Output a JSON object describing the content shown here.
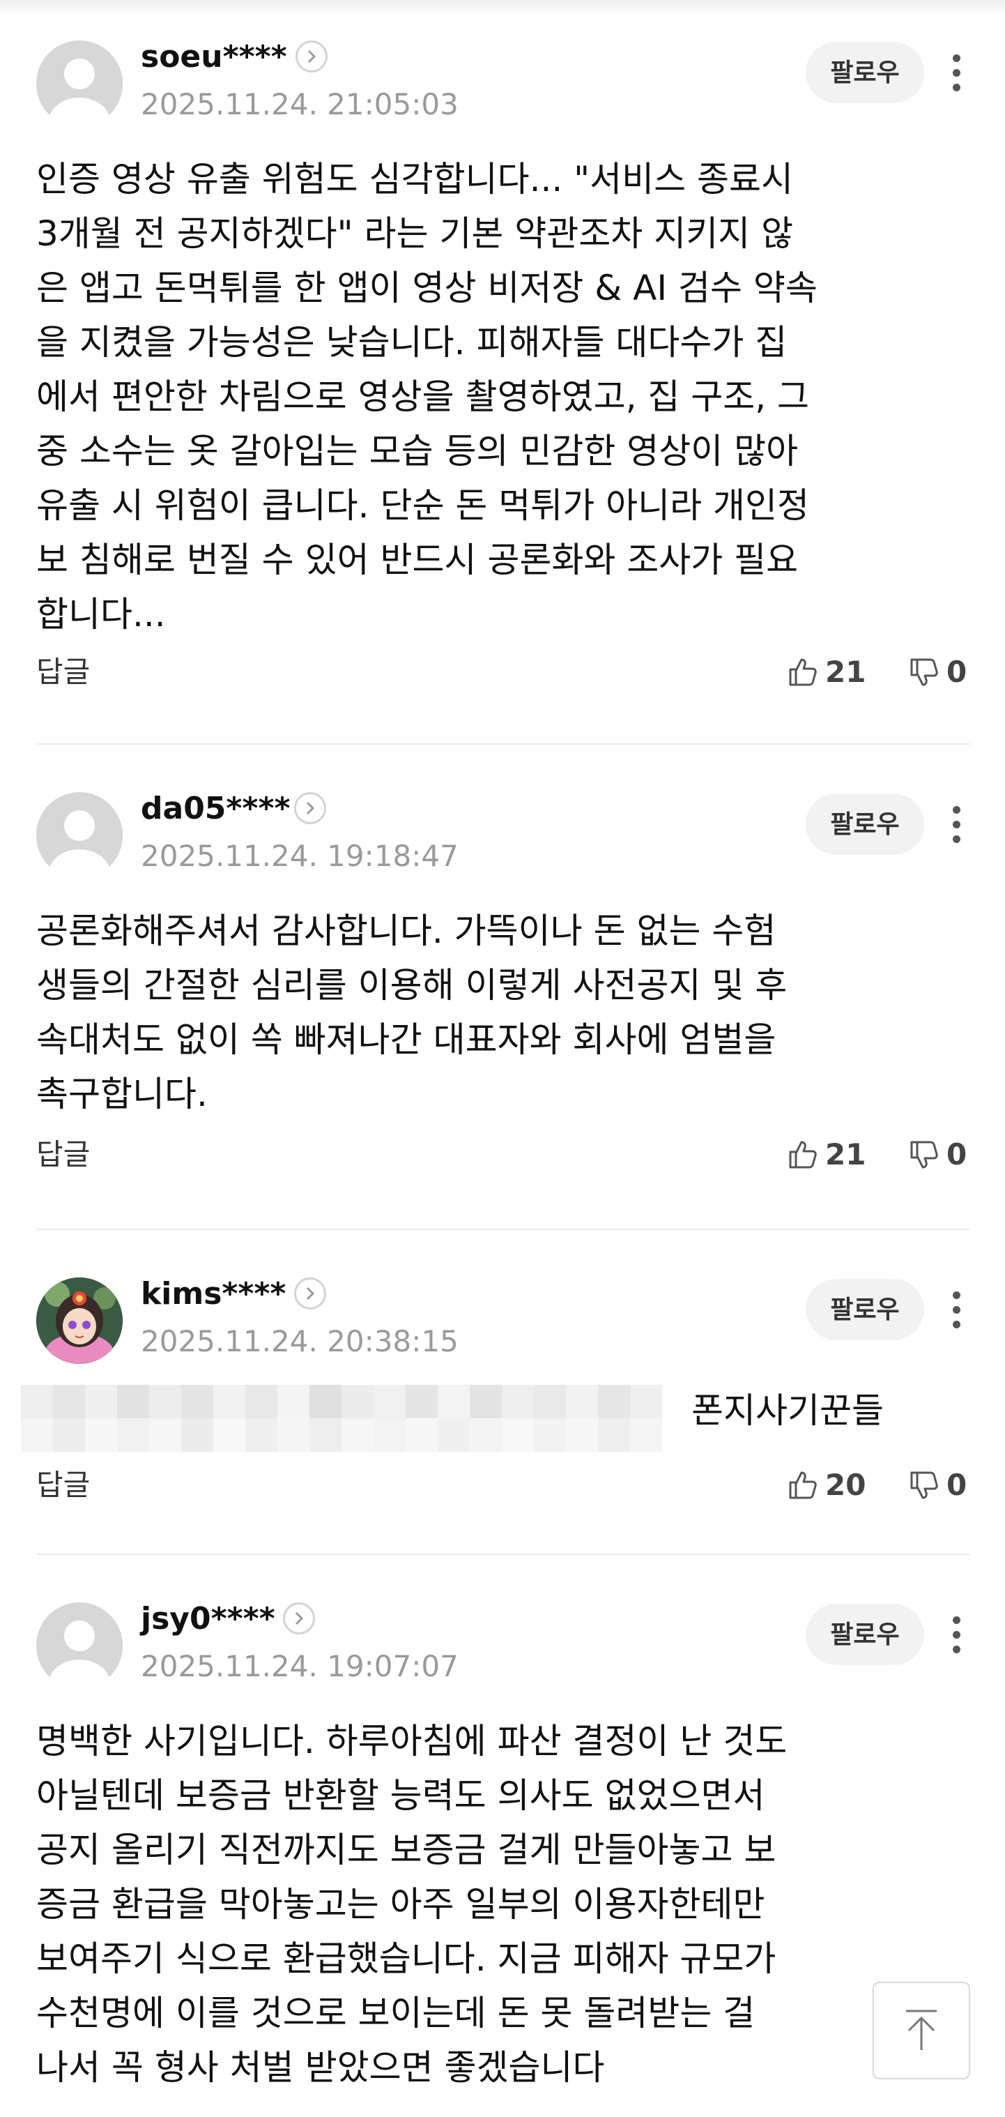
{
  "comments": [
    {
      "username": "soeu****",
      "timestamp": "2025.11.24. 21:05:03",
      "body": "인증 영상 유출 위험도 심각합니다... \"서비스 종료시\n3개월 전 공지하겠다\" 라는 기본 약관조차 지키지 않\n은 앱고 돈먹튀를 한 앱이 영상 비저장 & AI 검수 약속\n을 지켰을 가능성은 낮습니다. 피해자들 대다수가 집\n에서 편안한 차림으로 영상을 촬영하였고, 집 구조, 그\n중 소수는 옷 갈아입는 모습 등의 민감한 영상이 많아\n유출 시 위험이 큽니다. 단순 돈 먹튀가 아니라 개인정\n보 침해로 번질 수 있어 반드시 공론화와 조사가 필요\n합니다...",
      "follow_label": "팔로우",
      "reply_label": "답글",
      "likes": "21",
      "dislikes": "0"
    },
    {
      "username": "da05****",
      "timestamp": "2025.11.24. 19:18:47",
      "body": "공론화해주셔서 감사합니다. 가뜩이나 돈 없는 수험\n생들의 간절한 심리를 이용해 이렇게 사전공지 및 후\n속대처도 없이 쏙 빠져나간 대표자와 회사에 엄벌을\n촉구합니다.",
      "follow_label": "팔로우",
      "reply_label": "답글",
      "likes": "21",
      "dislikes": "0"
    },
    {
      "username": "kims****",
      "timestamp": "2025.11.24. 20:38:15",
      "body": "폰지사기꾼들",
      "follow_label": "팔로우",
      "reply_label": "답글",
      "likes": "20",
      "dislikes": "0"
    },
    {
      "username": "jsy0****",
      "timestamp": "2025.11.24. 19:07:07",
      "body": "명백한 사기입니다. 하루아침에 파산 결정이 난 것도\n아닐텐데 보증금 반환할 능력도 의사도 없었으면서\n공지 올리기 직전까지도 보증금 걸게 만들아놓고 보\n증금 환급을 막아놓고는 아주 일부의 이용자한테만\n보여주기 식으로 환급했습니다. 지금 피해자 규모가\n수천명에 이를 것으로 보이는데 돈 못 돌려받는 걸\n나서 꼭 형사 처벌 받았으면 좋겠습니다",
      "follow_label": "팔로우"
    }
  ],
  "icons": {
    "avatar_default": "default-user-avatar-icon",
    "avatar_custom": "character-avatar-icon",
    "chevron": "chevron-right-icon",
    "more": "vertical-dots-icon",
    "like": "thumbs-up-icon",
    "dislike": "thumbs-down-icon",
    "scroll_top": "arrow-up-to-top-icon"
  },
  "colors": {
    "text": "#111111",
    "muted": "#9a9a9a",
    "follow_bg": "#f2f2f2",
    "divider": "#ececec"
  }
}
